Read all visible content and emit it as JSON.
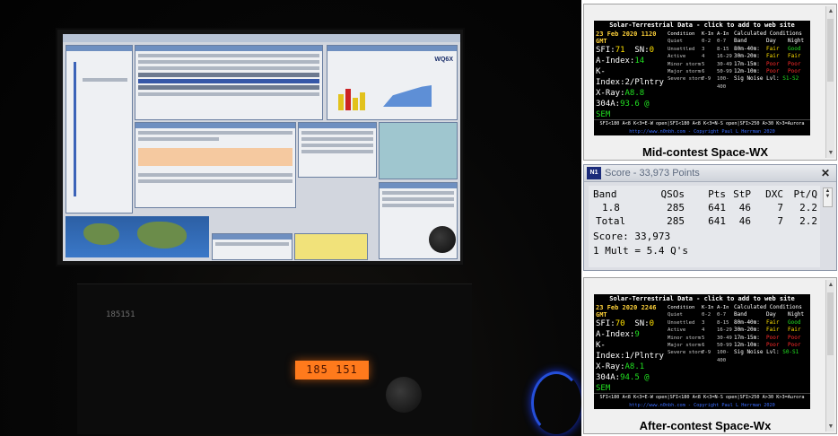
{
  "photo": {
    "desc_radio_display": "185 151",
    "radio_small_label": "185151"
  },
  "wx_top": {
    "banner_title": "Solar-Terrestrial Data - click to add to web site",
    "datetime": "23 Feb 2020 1120 GMT",
    "sfi_label": "SFI:",
    "sfi": "71",
    "sn_label": "SN:",
    "sn": "0",
    "a_label": "A-Index:",
    "a": "14",
    "k_label": "K-Index:",
    "k": "2/Plntry",
    "xray_label": "X-Ray:",
    "xray": "A8.8",
    "304_label": "304A:",
    "304": "93.6 @ SEM",
    "kidx_header": [
      "Condition",
      "K-In",
      "A-In"
    ],
    "kidx_rows": [
      [
        "Quiet",
        "0-2",
        "0-7"
      ],
      [
        "Unsettled",
        "3",
        "8-15"
      ],
      [
        "Active",
        "4",
        "16-29"
      ],
      [
        "Minor storm",
        "5",
        "30-49"
      ],
      [
        "Major storm",
        "6",
        "50-99"
      ],
      [
        "Severe storm",
        "7-9",
        "100-400"
      ]
    ],
    "cond_title": "Calculated Conditions",
    "cond_header": [
      "Band",
      "Day",
      "Night"
    ],
    "cond_rows": [
      [
        "80m-40m:",
        "Fair",
        "Good"
      ],
      [
        "30m-20m:",
        "Fair",
        "Fair"
      ],
      [
        "17m-15m:",
        "Poor",
        "Poor"
      ],
      [
        "12m-10m:",
        "Poor",
        "Poor"
      ]
    ],
    "sig_noise_label": "Sig Noise Lvl:",
    "sig_noise": "S1-S2",
    "footer": "SFI<180 A<8 K<3=E-W open|SFI<180 A<8 K<3=N-S open|SFI>250 A>30 K>3=Aurora",
    "url": "http://www.n0nbh.com - Copyright Paul L Herrman 2020",
    "caption": "Mid-contest  Space-WX"
  },
  "score": {
    "icon_label": "N1",
    "title": "Score - 33,973 Points",
    "close": "✕",
    "headers": [
      "Band",
      "QSOs",
      "Pts",
      "StP",
      "DXC",
      "Pt/Q"
    ],
    "rows": [
      [
        "1.8",
        "285",
        "641",
        "46",
        "7",
        "2.2"
      ],
      [
        "Total",
        "285",
        "641",
        "46",
        "7",
        "2.2"
      ]
    ],
    "score_line": "Score: 33,973",
    "mult_line": "1 Mult = 5.4 Q's"
  },
  "wx_bottom": {
    "banner_title": "Solar-Terrestrial Data - click to add to web site",
    "datetime": "23 Feb 2020 2246 GMT",
    "sfi_label": "SFI:",
    "sfi": "70",
    "sn_label": "SN:",
    "sn": "0",
    "a_label": "A-Index:",
    "a": "9",
    "k_label": "K-Index:",
    "k": "1/Plntry",
    "xray_label": "X-Ray:",
    "xray": "A8.1",
    "304_label": "304A:",
    "304": "94.5 @ SEM",
    "kidx_header": [
      "Condition",
      "K-In",
      "A-In"
    ],
    "kidx_rows": [
      [
        "Quiet",
        "0-2",
        "0-7"
      ],
      [
        "Unsettled",
        "3",
        "8-15"
      ],
      [
        "Active",
        "4",
        "16-29"
      ],
      [
        "Minor storm",
        "5",
        "30-49"
      ],
      [
        "Major storm",
        "6",
        "50-99"
      ],
      [
        "Severe storm",
        "7-9",
        "100-400"
      ]
    ],
    "cond_title": "Calculated Conditions",
    "cond_header": [
      "Band",
      "Day",
      "Night"
    ],
    "cond_rows": [
      [
        "80m-40m:",
        "Fair",
        "Good"
      ],
      [
        "30m-20m:",
        "Fair",
        "Fair"
      ],
      [
        "17m-15m:",
        "Poor",
        "Poor"
      ],
      [
        "12m-10m:",
        "Poor",
        "Poor"
      ]
    ],
    "sig_noise_label": "Sig Noise Lvl:",
    "sig_noise": "S0-S1",
    "footer": "SFI<180 A<8 K<3=E-W open|SFI<180 A<8 K<3=N-S open|SFI>250 A>30 K>3=Aurora",
    "url": "http://www.n0nbh.com - Copyright Paul L Herrman 2020",
    "caption": "After-contest  Space-Wx"
  },
  "colors": {
    "fair": "#ffe000",
    "good": "#21e021",
    "poor": "#ff2a2a"
  }
}
